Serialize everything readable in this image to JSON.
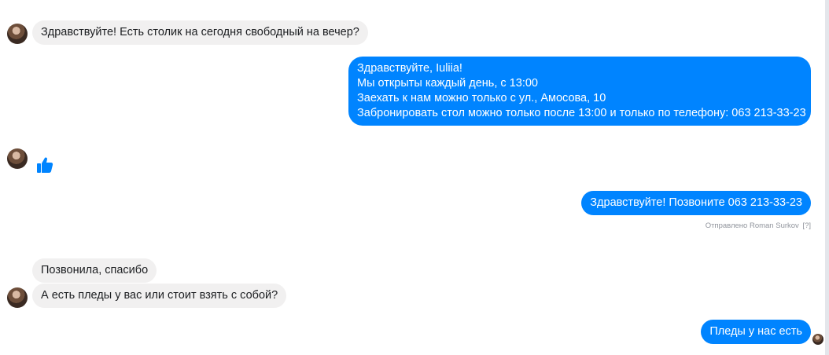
{
  "messages": {
    "m1": "Здравствуйте! Есть столик на сегодня свободный на вечер?",
    "m2_lines": [
      "Здравствуйте, Iuliia!",
      "Мы открыты каждый день, с 13:00",
      "Заехать к нам можно только с ул., Амосова, 10",
      "Забронировать стол можно только после 13:00 и только по телефону: 063 213-33-23"
    ],
    "m3": "Здравствуйте! Позвоните 063 213-33-23",
    "m4": "Позвонила, спасибо",
    "m5": "А есть пледы у вас или стоит взять с собой?",
    "m6": "Пледы у нас есть"
  },
  "sent_note": {
    "text": "Отправлено Roman Surkov",
    "help": "[?]"
  },
  "icons": {
    "like": "thumbs-up-icon"
  },
  "colors": {
    "outgoing": "#0084ff",
    "incoming": "#f1f0f0"
  }
}
